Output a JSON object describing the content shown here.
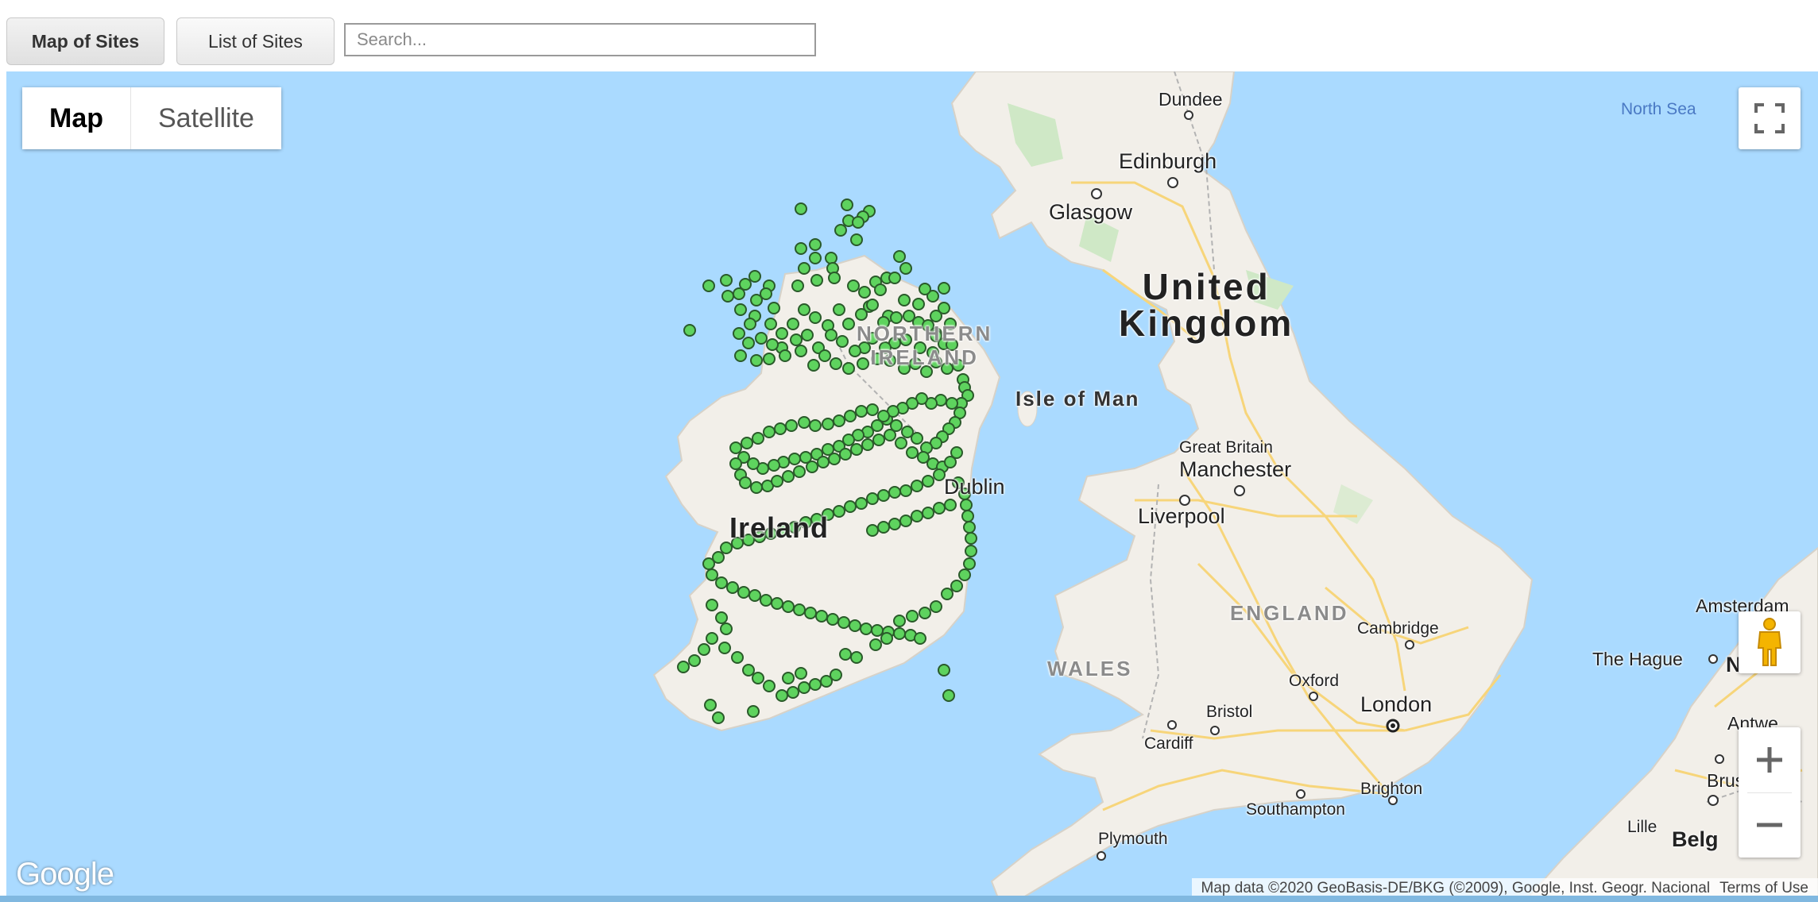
{
  "toolbar": {
    "map_tab": "Map of Sites",
    "list_tab": "List of Sites",
    "search_placeholder": "Search..."
  },
  "map_type": {
    "map_label": "Map",
    "satellite_label": "Satellite",
    "selected": "Map"
  },
  "labels": {
    "united_kingdom": "United\nKingdom",
    "northern_ireland": "NORTHERN\nIRELAND",
    "ireland": "Ireland",
    "england": "ENGLAND",
    "wales": "WALES",
    "isle_of_man": "Isle of Man",
    "north_sea": "North Sea",
    "great_britain": "Great Britain",
    "dundee": "Dundee",
    "edinburgh": "Edinburgh",
    "glasgow": "Glasgow",
    "manchester": "Manchester",
    "liverpool": "Liverpool",
    "dublin": "Dublin",
    "cambridge": "Cambridge",
    "oxford": "Oxford",
    "london": "London",
    "bristol": "Bristol",
    "cardiff": "Cardiff",
    "brighton": "Brighton",
    "southampton": "Southampton",
    "plymouth": "Plymouth",
    "amsterdam": "Amsterdam",
    "the_hague": "The Hague",
    "antwerp": "Antwe",
    "brussels": "Brusse",
    "lille": "Lille",
    "belgium": "Belg",
    "netherlands": "Neth"
  },
  "attribution": {
    "map_data": "Map data ©2020 GeoBasis-DE/BKG (©2009), Google, Inst. Geogr. Nacional",
    "terms": "Terms of Use"
  },
  "logo": "Google",
  "colors": {
    "water": "#aadaff",
    "land": "#f2efe9",
    "marker_fill": "#5ed35e",
    "marker_stroke": "#2a5a2a"
  },
  "site_markers": {
    "count_visible_approx": 260,
    "color": "#5ed35e"
  }
}
